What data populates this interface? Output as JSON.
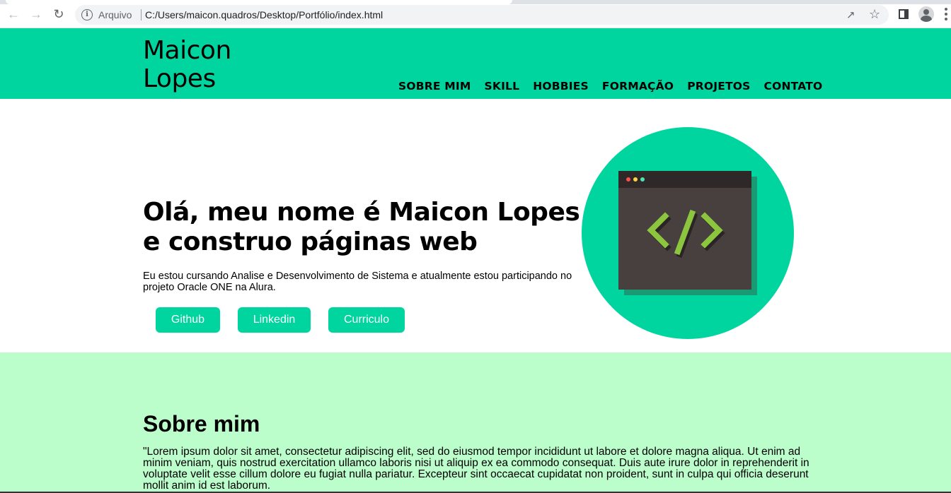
{
  "browser": {
    "protocol_label": "Arquivo",
    "url": "C:/Users/maicon.quadros/Desktop/Portfólio/index.html"
  },
  "header": {
    "logo_line1": "Maicon",
    "logo_line2": "Lopes",
    "nav": [
      "SOBRE MIM",
      "SKILL",
      "HOBBIES",
      "FORMAÇÃO",
      "PROJETOS",
      "CONTATO"
    ]
  },
  "hero": {
    "title": "Olá, meu nome é Maicon Lopes e construo páginas web",
    "description": "Eu estou cursando Analise e Desenvolvimento de Sistema e atualmente estou participando no projeto Oracle ONE na Alura.",
    "buttons": [
      "Github",
      "Linkedin",
      "Curriculo"
    ]
  },
  "about": {
    "title": "Sobre mim",
    "text": "\"Lorem ipsum dolor sit amet, consectetur adipiscing elit, sed do eiusmod tempor incididunt ut labore et dolore magna aliqua. Ut enim ad minim veniam, quis nostrud exercitation ullamco laboris nisi ut aliquip ex ea commodo consequat. Duis aute irure dolor in reprehenderit in voluptate velit esse cillum dolore eu fugiat nulla pariatur. Excepteur sint occaecat cupidatat non proident, sunt in culpa qui officia deserunt mollit anim id est laborum."
  },
  "colors": {
    "accent": "#00d59f",
    "about_bg": "#bcfecb",
    "code_window": "#48403f",
    "code_symbol": "#8cc63f"
  }
}
